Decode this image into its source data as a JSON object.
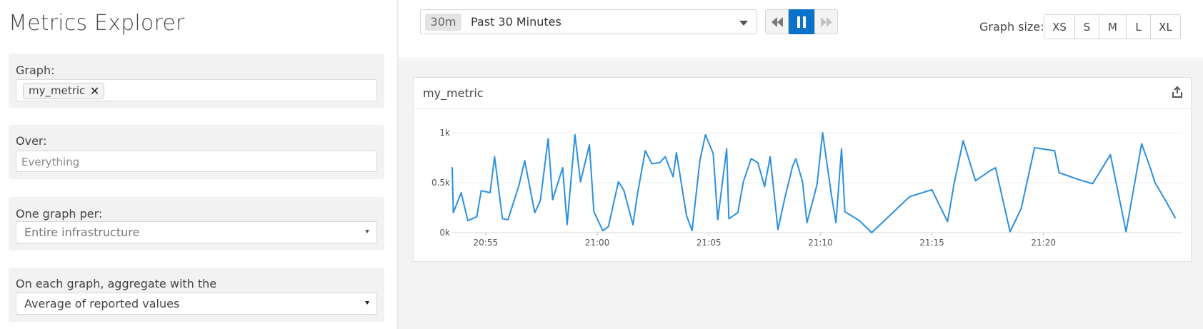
{
  "sidebar": {
    "title": "Metrics Explorer",
    "graph": {
      "label": "Graph:",
      "tags": [
        "my_metric"
      ]
    },
    "over": {
      "label": "Over:",
      "placeholder": "Everything"
    },
    "one_graph_per": {
      "label": "One graph per:",
      "value": "Entire infrastructure"
    },
    "aggregate": {
      "label": "On each graph, aggregate with the",
      "value": "Average of reported values"
    }
  },
  "toolbar": {
    "time_badge": "30m",
    "time_label": "Past 30 Minutes",
    "playback": {
      "active": "pause"
    },
    "graph_size_label": "Graph size:",
    "graph_sizes": [
      "XS",
      "S",
      "M",
      "L",
      "XL"
    ]
  },
  "graph": {
    "title": "my_metric"
  },
  "colors": {
    "line": "#2b8fe0",
    "accent": "#0b72c9"
  },
  "chart_data": {
    "type": "line",
    "title": "my_metric",
    "x_unit": "time (HH:MM)",
    "x_tick_labels": [
      "20:55",
      "21:00",
      "21:05",
      "21:10",
      "21:15",
      "21:20"
    ],
    "y_tick_labels": [
      "0k",
      "0.5k",
      "1k"
    ],
    "ylim": [
      0,
      1000
    ],
    "grid": true,
    "series": [
      {
        "values": [
          [
            -1.5,
            650
          ],
          [
            -1.45,
            200
          ],
          [
            -1.1,
            400
          ],
          [
            -0.8,
            120
          ],
          [
            -0.4,
            160
          ],
          [
            -0.2,
            420
          ],
          [
            0.2,
            400
          ],
          [
            0.4,
            760
          ],
          [
            0.75,
            140
          ],
          [
            1.0,
            130
          ],
          [
            1.5,
            480
          ],
          [
            1.75,
            720
          ],
          [
            2.2,
            200
          ],
          [
            2.45,
            320
          ],
          [
            2.8,
            940
          ],
          [
            3.0,
            330
          ],
          [
            3.45,
            650
          ],
          [
            3.65,
            80
          ],
          [
            4.0,
            980
          ],
          [
            4.25,
            510
          ],
          [
            4.65,
            880
          ],
          [
            4.85,
            210
          ],
          [
            5.25,
            20
          ],
          [
            5.5,
            60
          ],
          [
            5.95,
            510
          ],
          [
            6.2,
            420
          ],
          [
            6.6,
            80
          ],
          [
            6.8,
            380
          ],
          [
            7.15,
            820
          ],
          [
            7.45,
            690
          ],
          [
            7.8,
            700
          ],
          [
            8.05,
            760
          ],
          [
            8.4,
            560
          ],
          [
            8.55,
            800
          ],
          [
            9.0,
            170
          ],
          [
            9.25,
            20
          ],
          [
            9.6,
            720
          ],
          [
            9.85,
            980
          ],
          [
            10.2,
            790
          ],
          [
            10.4,
            130
          ],
          [
            10.8,
            840
          ],
          [
            10.9,
            140
          ],
          [
            11.3,
            200
          ],
          [
            11.55,
            510
          ],
          [
            11.9,
            740
          ],
          [
            12.2,
            700
          ],
          [
            12.5,
            460
          ],
          [
            12.75,
            760
          ],
          [
            13.1,
            30
          ],
          [
            13.4,
            340
          ],
          [
            13.75,
            660
          ],
          [
            13.9,
            740
          ],
          [
            14.2,
            510
          ],
          [
            14.4,
            100
          ],
          [
            14.85,
            480
          ],
          [
            15.1,
            1000
          ],
          [
            15.5,
            370
          ],
          [
            15.7,
            100
          ],
          [
            15.95,
            840
          ],
          [
            16.1,
            210
          ],
          [
            16.75,
            120
          ],
          [
            17.3,
            0
          ],
          [
            18.2,
            190
          ],
          [
            19.0,
            360
          ],
          [
            20.0,
            430
          ],
          [
            20.7,
            110
          ],
          [
            21.0,
            500
          ],
          [
            21.4,
            920
          ],
          [
            21.95,
            520
          ],
          [
            22.35,
            580
          ],
          [
            22.6,
            620
          ],
          [
            22.85,
            650
          ],
          [
            23.5,
            10
          ],
          [
            24.0,
            240
          ],
          [
            24.6,
            850
          ],
          [
            25.5,
            820
          ],
          [
            25.7,
            600
          ],
          [
            26.6,
            530
          ],
          [
            27.2,
            490
          ],
          [
            28.0,
            780
          ],
          [
            28.7,
            10
          ],
          [
            29.4,
            890
          ],
          [
            29.8,
            640
          ],
          [
            30.0,
            500
          ],
          [
            30.5,
            310
          ],
          [
            30.9,
            150
          ]
        ]
      }
    ],
    "x_domain_minutes": [
      -1.5,
      30.9
    ]
  }
}
